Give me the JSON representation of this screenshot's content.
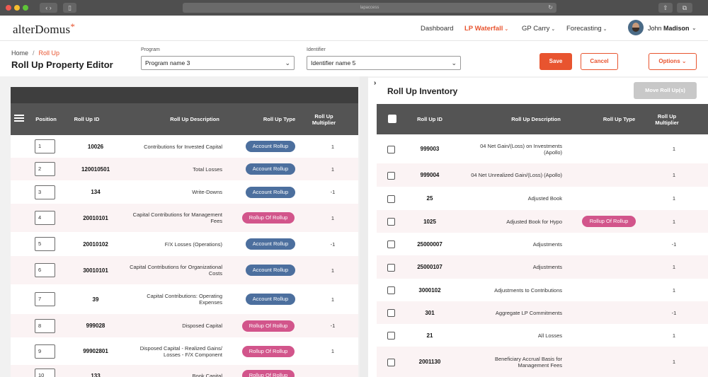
{
  "browser": {
    "url": "lapaccess"
  },
  "header": {
    "logo": "alterDomus",
    "logo_star": "*",
    "nav": [
      {
        "label": "Dashboard",
        "chevron": ""
      },
      {
        "label": "LP Waterfall",
        "chevron": "⌄"
      },
      {
        "label": "GP Carry",
        "chevron": "⌄"
      },
      {
        "label": "Forecasting",
        "chevron": "⌄"
      }
    ],
    "user_first": "John",
    "user_last": "Madison"
  },
  "breadcrumb": {
    "home": "Home",
    "separator": "/",
    "current": "Roll Up"
  },
  "page_title": "Roll Up Property Editor",
  "filters": {
    "program_label": "Program",
    "program_value": "Program name 3",
    "identifier_label": "Identifier",
    "identifier_value": "Identifier name 5"
  },
  "actions": {
    "save": "Save",
    "cancel": "Cancel",
    "options": "Options"
  },
  "left_table": {
    "headers": {
      "position": "Position",
      "rollup_id": "Roll Up ID",
      "description": "Roll Up Description",
      "type": "Roll Up Type",
      "multiplier_line1": "Roll Up",
      "multiplier_line2": "Multiplier"
    },
    "rows": [
      {
        "position": "1",
        "id": "10026",
        "desc1": "Contributions for Invested Capital",
        "desc2": "",
        "type": "Account Rollup",
        "kind": "account",
        "mult": "1"
      },
      {
        "position": "2",
        "id": "120010501",
        "desc1": "Total Losses",
        "desc2": "",
        "type": "Account Rollup",
        "kind": "account",
        "mult": "1"
      },
      {
        "position": "3",
        "id": "134",
        "desc1": "Write-Downs",
        "desc2": "",
        "type": "Account Rollup",
        "kind": "account",
        "mult": "-1"
      },
      {
        "position": "4",
        "id": "20010101",
        "desc1": "Capital Contributions for Management",
        "desc2": "Fees",
        "type": "Rollup Of Rollup",
        "kind": "rollup",
        "mult": "1"
      },
      {
        "position": "5",
        "id": "20010102",
        "desc1": "F/X Losses (Operations)",
        "desc2": "",
        "type": "Account Rollup",
        "kind": "account",
        "mult": "-1"
      },
      {
        "position": "6",
        "id": "30010101",
        "desc1": "Capital Contributions for Organizational",
        "desc2": "Costs",
        "type": "Account Rollup",
        "kind": "account",
        "mult": "1"
      },
      {
        "position": "7",
        "id": "39",
        "desc1": "Capital Contributions: Operating",
        "desc2": "Expenses",
        "type": "Account Rollup",
        "kind": "account",
        "mult": "1"
      },
      {
        "position": "8",
        "id": "999028",
        "desc1": "Disposed Capital",
        "desc2": "",
        "type": "Rollup Of Rollup",
        "kind": "rollup",
        "mult": "-1"
      },
      {
        "position": "9",
        "id": "99902801",
        "desc1": "Disposed Capital - Realized Gains/",
        "desc2": "Losses - F/X Component",
        "type": "Rollup Of Rollup",
        "kind": "rollup",
        "mult": "1"
      },
      {
        "position": "10",
        "id": "133",
        "desc1": "Book Capital",
        "desc2": "",
        "type": "Rollup Of Rollup",
        "kind": "rollup",
        "mult": ""
      }
    ]
  },
  "inventory": {
    "title": "Roll Up Inventory",
    "move_button": "Move Roll Up(s)",
    "headers": {
      "rollup_id": "Roll Up ID",
      "description": "Roll Up Description",
      "type": "Roll Up Type",
      "multiplier_line1": "Roll Up",
      "multiplier_line2": "Multiplier"
    },
    "rows": [
      {
        "id": "999003",
        "desc1": "04 Net Gain/(Loss) on Investments",
        "desc2": "(Apollo)",
        "type": "",
        "mult": "1"
      },
      {
        "id": "999004",
        "desc1": "04 Net Unrealized Gain/(Loss) (Apollo)",
        "desc2": "",
        "type": "",
        "mult": "1"
      },
      {
        "id": "25",
        "desc1": "Adjusted Book",
        "desc2": "",
        "type": "",
        "mult": "1"
      },
      {
        "id": "1025",
        "desc1": "Adjusted Book for Hypo",
        "desc2": "",
        "type": "Rollup Of Rollup",
        "mult": "1"
      },
      {
        "id": "25000007",
        "desc1": "Adjustments",
        "desc2": "",
        "type": "",
        "mult": "-1"
      },
      {
        "id": "25000107",
        "desc1": "Adjustments",
        "desc2": "",
        "type": "",
        "mult": "1"
      },
      {
        "id": "3000102",
        "desc1": "Adjustments to Contributions",
        "desc2": "",
        "type": "",
        "mult": "1"
      },
      {
        "id": "301",
        "desc1": "Aggregate LP Commitments",
        "desc2": "",
        "type": "",
        "mult": "-1"
      },
      {
        "id": "21",
        "desc1": "All Losses",
        "desc2": "",
        "type": "",
        "mult": "1"
      },
      {
        "id": "2001130",
        "desc1": "Beneficiary Accrual Basis for",
        "desc2": "Management Fees",
        "type": "",
        "mult": "1"
      }
    ]
  },
  "colors": {
    "accent": "#e8542f",
    "account_pill": "#4c6f9e",
    "rollup_pill": "#d2558b",
    "header_bg": "#545454"
  }
}
